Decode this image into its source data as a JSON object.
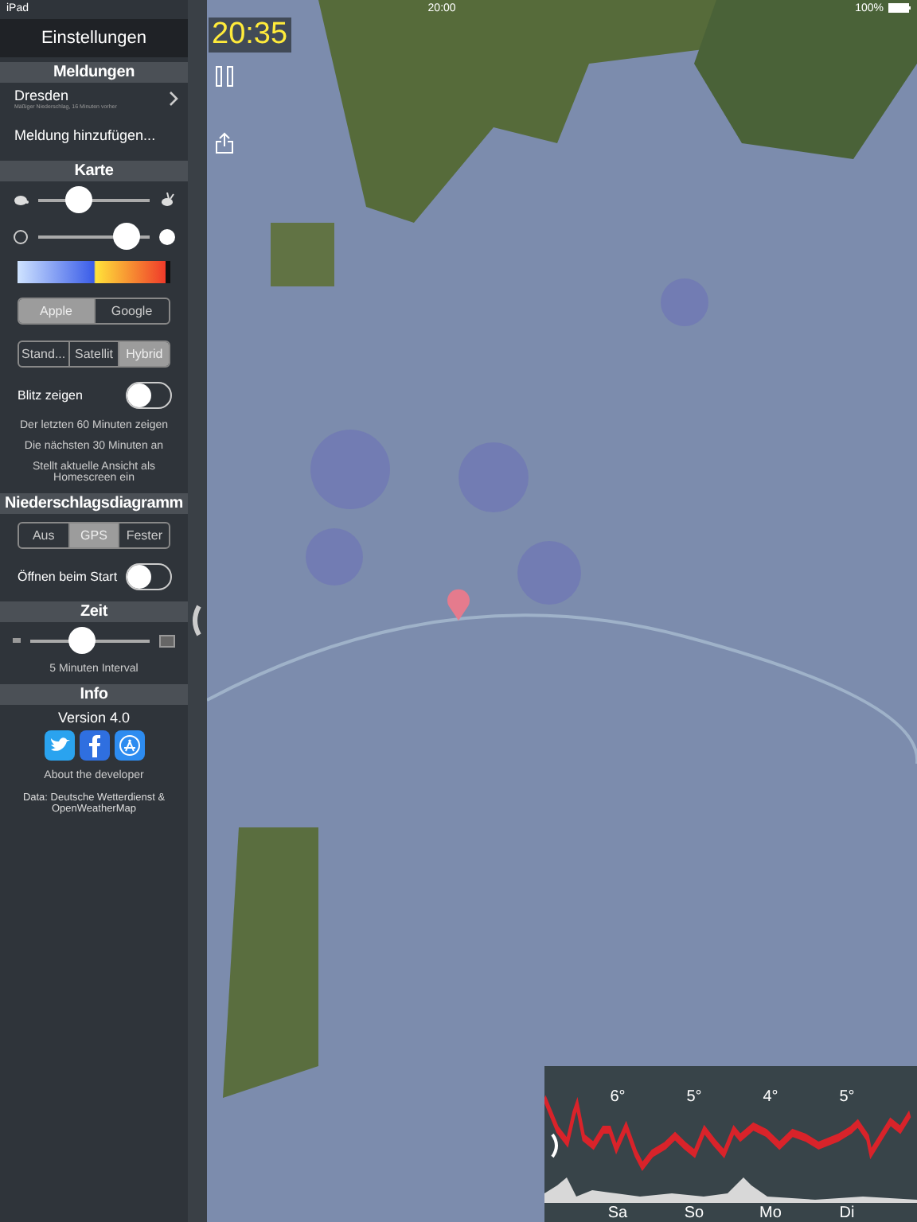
{
  "status_bar": {
    "device": "iPad",
    "time": "20:00",
    "battery": "100%"
  },
  "sidebar": {
    "title": "Einstellungen",
    "sections": [
      {
        "heading": "Meldungen",
        "items": [
          {
            "kind": "alert",
            "label": "Dresden",
            "detail": "Mäßiger Niederschlag, 16 Minuten vorher"
          },
          {
            "kind": "link",
            "label": "Meldung hinzufügen..."
          }
        ]
      },
      {
        "heading": "Karte",
        "items": [
          {
            "kind": "speed",
            "level": 0.35
          },
          {
            "kind": "size",
            "level": 0.78
          },
          {
            "kind": "gradient"
          },
          {
            "kind": "segmented",
            "options": [
              {
                "label": "Apple",
                "selected": true
              },
              {
                "label": "Google",
                "selected": false
              }
            ]
          },
          {
            "kind": "segmented",
            "options": [
              {
                "label": "Stand...",
                "selected": false
              },
              {
                "label": "Satellit",
                "selected": false
              },
              {
                "label": "Hybrid",
                "selected": true
              }
            ]
          },
          {
            "kind": "toggle",
            "label": "Blitz zeigen",
            "on": false
          },
          {
            "kind": "note",
            "label": "Der letzten 60 Minuten zeigen"
          },
          {
            "kind": "note",
            "label": "Die nächsten 30 Minuten an"
          },
          {
            "kind": "note",
            "label": "Stellt aktuelle Ansicht als Homescreen ein"
          }
        ]
      },
      {
        "heading": "Niederschlagsdiagramm",
        "items": [
          {
            "kind": "segmented",
            "options": [
              {
                "label": "Aus",
                "selected": false
              },
              {
                "label": "GPS",
                "selected": true
              },
              {
                "label": "Fester",
                "selected": false
              }
            ]
          },
          {
            "kind": "toggle",
            "label": "Öffnen beim Start",
            "on": false
          }
        ]
      },
      {
        "heading": "Zeit",
        "items": [
          {
            "kind": "time",
            "level": 0.42
          },
          {
            "kind": "note",
            "label": "5 Minuten Interval"
          }
        ]
      },
      {
        "heading": "Info",
        "items": [
          {
            "kind": "version",
            "label": "Version 4.0"
          },
          {
            "kind": "icons"
          },
          {
            "kind": "note",
            "label": "About the developer"
          },
          {
            "kind": "small",
            "label": "Data: Deutsche Wetterdienst & OpenWeatherMap"
          }
        ]
      }
    ]
  },
  "map": {
    "clock": "20:35"
  },
  "forecast": {
    "temperatures": [
      "6°",
      "5°",
      "4°",
      "5°"
    ],
    "days": [
      "Sa",
      "So",
      "Mo",
      "Di"
    ]
  }
}
